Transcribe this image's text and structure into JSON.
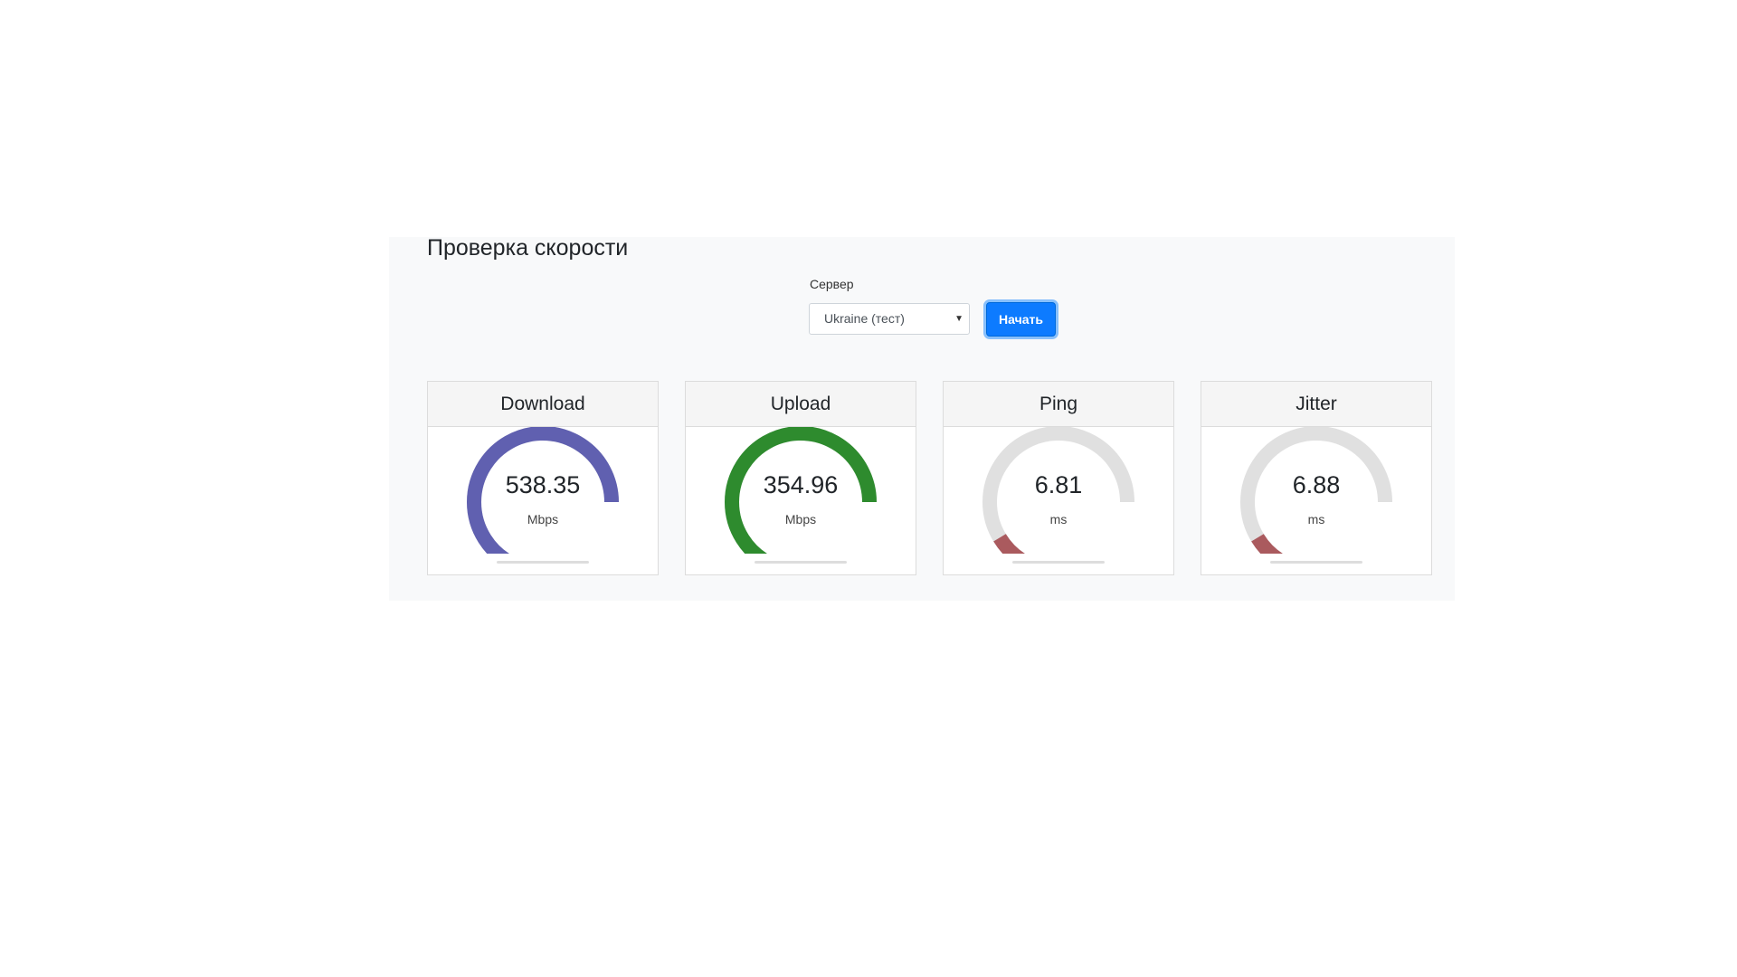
{
  "page_title": "Проверка скорости",
  "server": {
    "label": "Сервер",
    "selected": "Ukraine (тест)"
  },
  "start_button": "Начать",
  "colors": {
    "download": "#6060b0",
    "upload": "#2e8b2e",
    "ping": "#aa5a5e",
    "jitter": "#aa5a5e",
    "track": "#e0e0e0",
    "button": "#0d7bff"
  },
  "metrics": [
    {
      "key": "download",
      "title": "Download",
      "value": "538.35",
      "unit": "Mbps",
      "level": 1.0
    },
    {
      "key": "upload",
      "title": "Upload",
      "value": "354.96",
      "unit": "Mbps",
      "level": 1.0
    },
    {
      "key": "ping",
      "title": "Ping",
      "value": "6.81",
      "unit": "ms",
      "level": 0.12
    },
    {
      "key": "jitter",
      "title": "Jitter",
      "value": "6.88",
      "unit": "ms",
      "level": 0.12
    }
  ]
}
